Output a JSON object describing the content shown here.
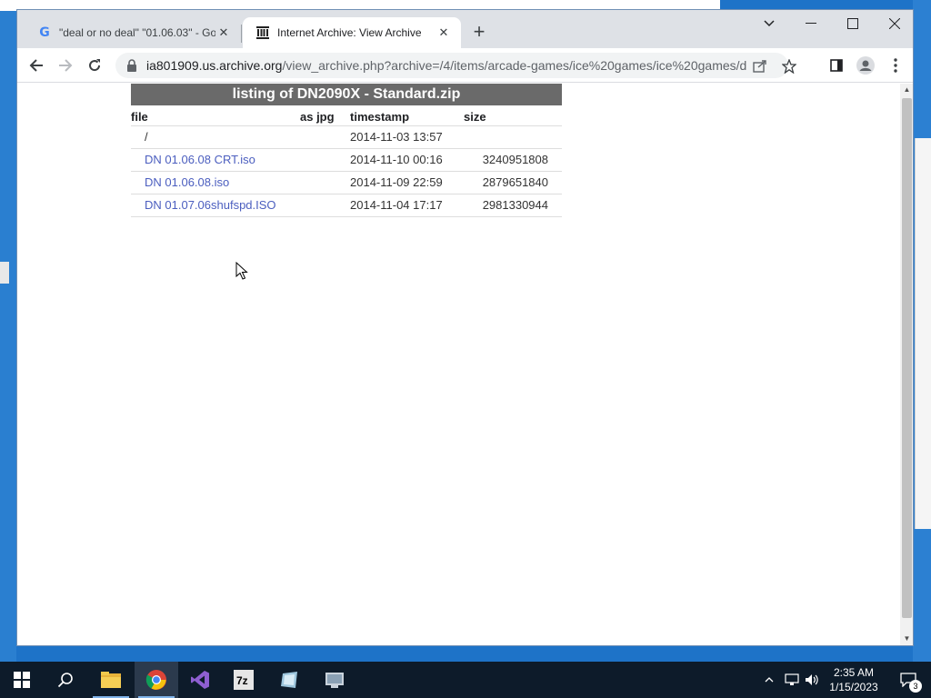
{
  "browser": {
    "tabs": [
      {
        "title": "\"deal or no deal\" \"01.06.03\" - Go",
        "favicon": "google-icon",
        "active": false
      },
      {
        "title": "Internet Archive: View Archive",
        "favicon": "internet-archive-icon",
        "active": true
      }
    ],
    "address": {
      "domain": "ia801909.us.archive.org",
      "path": "/view_archive.php?archive=/4/items/arcade-games/ice%20games/ice%20games/d..."
    }
  },
  "listing": {
    "title": "listing of DN2090X - Standard.zip",
    "headers": {
      "file": "file",
      "jpg": "as jpg",
      "timestamp": "timestamp",
      "size": "size"
    },
    "rows": [
      {
        "file": "/",
        "link": false,
        "timestamp": "2014-11-03 13:57",
        "size": ""
      },
      {
        "file": "DN 01.06.08 CRT.iso",
        "link": true,
        "timestamp": "2014-11-10 00:16",
        "size": "3240951808"
      },
      {
        "file": "DN 01.06.08.iso",
        "link": true,
        "timestamp": "2014-11-09 22:59",
        "size": "2879651840"
      },
      {
        "file": "DN 01.07.06shufspd.ISO",
        "link": true,
        "timestamp": "2014-11-04 17:17",
        "size": "2981330944"
      }
    ]
  },
  "taskbar": {
    "apps": [
      "start-icon",
      "search-icon",
      "file-explorer-icon",
      "chrome-icon",
      "visual-studio-icon",
      "7zip-icon",
      "app-icon",
      "app-icon-2"
    ],
    "clock": {
      "time": "2:35 AM",
      "date": "1/15/2023"
    },
    "notifications": "3"
  },
  "colors": {
    "link": "#4b5ebf",
    "listing_header_bg": "#6a6a6a",
    "taskbar": "#0d1b2a"
  }
}
